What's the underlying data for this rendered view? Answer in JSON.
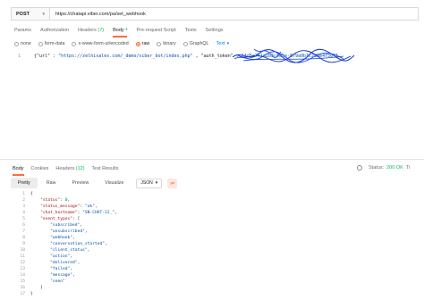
{
  "request": {
    "method": "POST",
    "url": "https://chatapi.viber.com/pa/set_webhook"
  },
  "request_tabs": [
    {
      "label": "Params",
      "count": "",
      "dot": false,
      "active": false
    },
    {
      "label": "Authorization",
      "count": "",
      "dot": false,
      "active": false
    },
    {
      "label": "Headers",
      "count": "(7)",
      "dot": false,
      "active": false
    },
    {
      "label": "Body",
      "count": "",
      "dot": true,
      "active": true
    },
    {
      "label": "Pre-request Script",
      "count": "",
      "dot": false,
      "active": false
    },
    {
      "label": "Tests",
      "count": "",
      "dot": false,
      "active": false
    },
    {
      "label": "Settings",
      "count": "",
      "dot": false,
      "active": false
    }
  ],
  "body_types": [
    {
      "label": "none",
      "selected": false
    },
    {
      "label": "form-data",
      "selected": false
    },
    {
      "label": "x-www-form-urlencoded",
      "selected": false
    },
    {
      "label": "raw",
      "selected": true
    },
    {
      "label": "binary",
      "selected": false
    },
    {
      "label": "GraphQL",
      "selected": false
    }
  ],
  "raw_format": "Text",
  "request_body": {
    "line_number": "1",
    "prefix": "{\"url\" : ",
    "url_value": "\"https://zelhisales.com/_demo/viber_bot/index.php\"",
    "mid": " , \"auth_token\" : ",
    "token_value": "\"4d5e7f1a2b3c4d5e-8f9a0b1c2d3e4f50\"",
    "suffix": "}"
  },
  "response_tabs": [
    {
      "label": "Body",
      "count": "",
      "active": true
    },
    {
      "label": "Cookies",
      "count": "",
      "active": false
    },
    {
      "label": "Headers",
      "count": "(12)",
      "active": false
    },
    {
      "label": "Test Results",
      "count": "",
      "active": false
    }
  ],
  "response_status": {
    "label": "Status:",
    "value": "200 OK",
    "time_label": "Ti"
  },
  "view_modes": [
    {
      "label": "Pretty",
      "active": true
    },
    {
      "label": "Raw",
      "active": false
    },
    {
      "label": "Preview",
      "active": false
    },
    {
      "label": "Visualize",
      "active": false
    }
  ],
  "response_format": "JSON",
  "response_lines": [
    {
      "n": "1",
      "indent": 0,
      "parts": [
        {
          "t": "p",
          "v": "{"
        }
      ]
    },
    {
      "n": "2",
      "indent": 1,
      "parts": [
        {
          "t": "k",
          "v": "\"status\""
        },
        {
          "t": "p",
          "v": ": "
        },
        {
          "t": "n",
          "v": "0"
        },
        {
          "t": "p",
          "v": ","
        }
      ]
    },
    {
      "n": "3",
      "indent": 1,
      "parts": [
        {
          "t": "k",
          "v": "\"status_message\""
        },
        {
          "t": "p",
          "v": ": "
        },
        {
          "t": "s",
          "v": "\"ok\""
        },
        {
          "t": "p",
          "v": ","
        }
      ]
    },
    {
      "n": "4",
      "indent": 1,
      "parts": [
        {
          "t": "k",
          "v": "\"chat_hostname\""
        },
        {
          "t": "p",
          "v": ": "
        },
        {
          "t": "s",
          "v": "\"SN-CHAT-12_\""
        },
        {
          "t": "p",
          "v": ","
        }
      ]
    },
    {
      "n": "5",
      "indent": 1,
      "parts": [
        {
          "t": "k",
          "v": "\"event_types\""
        },
        {
          "t": "p",
          "v": ": ["
        }
      ]
    },
    {
      "n": "6",
      "indent": 2,
      "parts": [
        {
          "t": "s",
          "v": "\"subscribed\""
        },
        {
          "t": "p",
          "v": ","
        }
      ]
    },
    {
      "n": "7",
      "indent": 2,
      "parts": [
        {
          "t": "s",
          "v": "\"unsubscribed\""
        },
        {
          "t": "p",
          "v": ","
        }
      ]
    },
    {
      "n": "8",
      "indent": 2,
      "parts": [
        {
          "t": "s",
          "v": "\"webhook\""
        },
        {
          "t": "p",
          "v": ","
        }
      ]
    },
    {
      "n": "9",
      "indent": 2,
      "parts": [
        {
          "t": "s",
          "v": "\"conversation_started\""
        },
        {
          "t": "p",
          "v": ","
        }
      ]
    },
    {
      "n": "10",
      "indent": 2,
      "parts": [
        {
          "t": "s",
          "v": "\"client_status\""
        },
        {
          "t": "p",
          "v": ","
        }
      ]
    },
    {
      "n": "11",
      "indent": 2,
      "parts": [
        {
          "t": "s",
          "v": "\"action\""
        },
        {
          "t": "p",
          "v": ","
        }
      ]
    },
    {
      "n": "12",
      "indent": 2,
      "parts": [
        {
          "t": "s",
          "v": "\"delivered\""
        },
        {
          "t": "p",
          "v": ","
        }
      ]
    },
    {
      "n": "13",
      "indent": 2,
      "parts": [
        {
          "t": "s",
          "v": "\"failed\""
        },
        {
          "t": "p",
          "v": ","
        }
      ]
    },
    {
      "n": "14",
      "indent": 2,
      "parts": [
        {
          "t": "s",
          "v": "\"message\""
        },
        {
          "t": "p",
          "v": ","
        }
      ]
    },
    {
      "n": "15",
      "indent": 2,
      "parts": [
        {
          "t": "s",
          "v": "\"seen\""
        }
      ]
    },
    {
      "n": "16",
      "indent": 1,
      "parts": [
        {
          "t": "p",
          "v": "]"
        }
      ]
    },
    {
      "n": "17",
      "indent": 0,
      "parts": [
        {
          "t": "p",
          "v": "}"
        }
      ]
    }
  ],
  "colors": {
    "accent": "#ff6c37",
    "success": "#0cbb52",
    "link": "#097bed"
  },
  "icons": [
    "chevron-down-icon",
    "globe-icon",
    "wrap-lines-icon",
    "scribble-redaction"
  ]
}
